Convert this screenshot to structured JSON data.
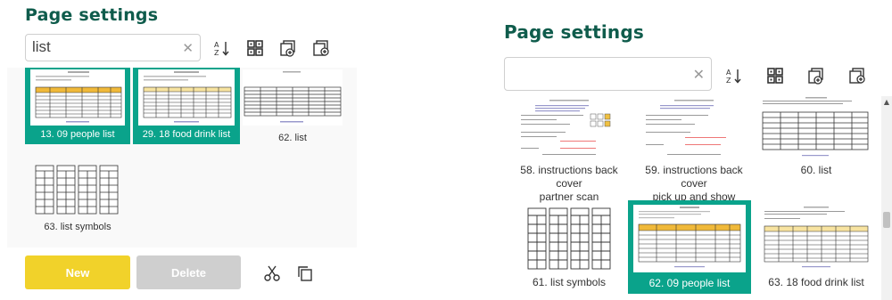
{
  "left": {
    "title": "Page settings",
    "search": {
      "value": "list",
      "placeholder": ""
    },
    "thumbs": [
      {
        "label": "13. 09 people list",
        "selected": true
      },
      {
        "label": "29. 18 food drink list",
        "selected": true
      },
      {
        "label": "62. list",
        "selected": false
      },
      {
        "label": "63. list symbols",
        "selected": false
      }
    ],
    "buttons": {
      "new": "New",
      "delete": "Delete"
    }
  },
  "right": {
    "title": "Page settings",
    "search": {
      "value": "",
      "placeholder": ""
    },
    "thumbs": [
      {
        "label_line1": "58. instructions back cover",
        "label_line2": "partner scan",
        "selected": false
      },
      {
        "label_line1": "59. instructions back cover",
        "label_line2": "pick up and show",
        "selected": false
      },
      {
        "label_line1": "60. list",
        "label_line2": "",
        "selected": false
      },
      {
        "label_line1": "61. list symbols",
        "label_line2": "",
        "selected": false
      },
      {
        "label_line1": "62. 09 people list",
        "label_line2": "",
        "selected": true
      },
      {
        "label_line1": "63. 18 food drink list",
        "label_line2": "",
        "selected": false
      }
    ]
  },
  "colors": {
    "title": "#0f5c4c",
    "selected": "#0aa38b",
    "new_button": "#f1d22a",
    "delete_button": "#cfcfcf"
  },
  "icons": [
    "sort-az-icon",
    "grid-icon",
    "add-page-icon",
    "insert-page-icon",
    "close-icon",
    "scissors-icon",
    "copy-icon"
  ]
}
